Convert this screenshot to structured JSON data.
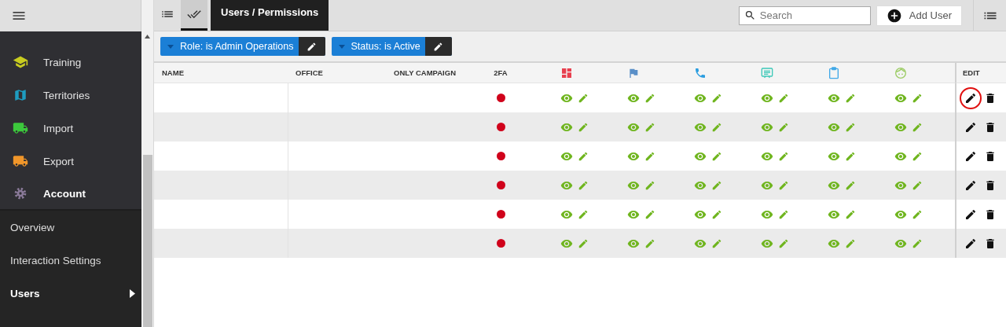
{
  "sidebar": {
    "sections": [
      {
        "label": "Training",
        "color": "#c8cc20",
        "expanded": false
      },
      {
        "label": "Territories",
        "color": "#1e9cc0",
        "expanded": false
      },
      {
        "label": "Import",
        "color": "#3cc83c",
        "expanded": false
      },
      {
        "label": "Export",
        "color": "#f0962a",
        "expanded": false
      },
      {
        "label": "Account",
        "color": "#8a7a99",
        "expanded": true
      }
    ],
    "subitems": [
      {
        "label": "Overview",
        "selected": false
      },
      {
        "label": "Interaction Settings",
        "selected": false
      },
      {
        "label": "Users",
        "selected": true
      }
    ]
  },
  "toolbar": {
    "view_tabs": [
      {
        "selected": false
      },
      {
        "selected": true
      }
    ],
    "title": "Users / Permissions",
    "search": {
      "placeholder": "Search"
    },
    "add_button": "Add User"
  },
  "filters": [
    {
      "label": "Role: is Admin Operations"
    },
    {
      "label": "Status: is Active"
    }
  ],
  "table": {
    "columns": [
      {
        "label": "NAME"
      },
      {
        "label": "OFFICE"
      },
      {
        "label": "ONLY CAMPAIGN"
      },
      {
        "label": "2FA"
      }
    ],
    "permission_columns": [
      {
        "color": "#e8404f"
      },
      {
        "color": "#5a8fc8"
      },
      {
        "color": "#2a9de0"
      },
      {
        "color": "#3cc8b8"
      },
      {
        "color": "#40a8e8"
      },
      {
        "color": "#9ccc65"
      }
    ],
    "edit_column": "EDIT",
    "rows": [
      {
        "two_fa": false,
        "highlighted": true,
        "permissions": [
          {
            "view": true,
            "edit": true
          },
          {
            "view": true,
            "edit": true
          },
          {
            "view": true,
            "edit": true
          },
          {
            "view": true,
            "edit": true
          },
          {
            "view": true,
            "edit": true
          },
          {
            "view": true,
            "edit": true
          }
        ]
      },
      {
        "two_fa": false,
        "highlighted": false,
        "permissions": [
          {
            "view": true,
            "edit": true
          },
          {
            "view": true,
            "edit": true
          },
          {
            "view": true,
            "edit": true
          },
          {
            "view": true,
            "edit": true
          },
          {
            "view": true,
            "edit": true
          },
          {
            "view": true,
            "edit": true
          }
        ]
      },
      {
        "two_fa": false,
        "highlighted": false,
        "permissions": [
          {
            "view": true,
            "edit": true
          },
          {
            "view": true,
            "edit": true
          },
          {
            "view": true,
            "edit": true
          },
          {
            "view": true,
            "edit": true
          },
          {
            "view": true,
            "edit": true
          },
          {
            "view": true,
            "edit": true
          }
        ]
      },
      {
        "two_fa": false,
        "highlighted": false,
        "permissions": [
          {
            "view": true,
            "edit": true
          },
          {
            "view": true,
            "edit": true
          },
          {
            "view": true,
            "edit": true
          },
          {
            "view": true,
            "edit": true
          },
          {
            "view": true,
            "edit": true
          },
          {
            "view": true,
            "edit": true
          }
        ]
      },
      {
        "two_fa": false,
        "highlighted": false,
        "permissions": [
          {
            "view": true,
            "edit": true
          },
          {
            "view": true,
            "edit": true
          },
          {
            "view": true,
            "edit": true
          },
          {
            "view": true,
            "edit": true
          },
          {
            "view": true,
            "edit": true
          },
          {
            "view": true,
            "edit": true
          }
        ]
      },
      {
        "two_fa": false,
        "highlighted": false,
        "permissions": [
          {
            "view": true,
            "edit": true
          },
          {
            "view": true,
            "edit": true
          },
          {
            "view": true,
            "edit": true
          },
          {
            "view": true,
            "edit": true
          },
          {
            "view": true,
            "edit": true
          },
          {
            "view": true,
            "edit": true
          }
        ]
      }
    ]
  }
}
